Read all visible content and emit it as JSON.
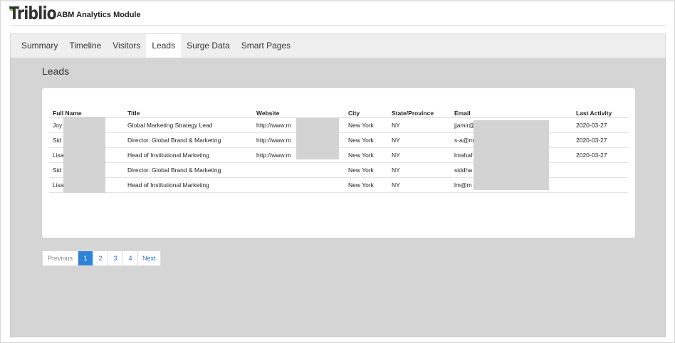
{
  "app": {
    "logo_text": "Triblio",
    "title": "ABM Analytics Module"
  },
  "tabs": [
    {
      "label": "Summary",
      "active": false
    },
    {
      "label": "Timeline",
      "active": false
    },
    {
      "label": "Visitors",
      "active": false
    },
    {
      "label": "Leads",
      "active": true
    },
    {
      "label": "Surge Data",
      "active": false
    },
    {
      "label": "Smart Pages",
      "active": false
    }
  ],
  "leads": {
    "heading": "Leads",
    "columns": [
      "Full Name",
      "Title",
      "Website",
      "City",
      "State/Province",
      "Email",
      "Last Activity"
    ],
    "rows": [
      [
        "Joy",
        "Global Marketing Strategy Lead",
        "http://www.m",
        "New York",
        "NY",
        "jjamir@",
        "2020-03-27"
      ],
      [
        "Sid",
        "Director. Global Brand & Marketing",
        "http://www.m",
        "New York",
        "NY",
        "s-a@m",
        "2020-03-27"
      ],
      [
        "Lisa",
        "Head of Institutional Marketing",
        "http://www.m",
        "New York",
        "NY",
        "lmahaf",
        "2020-03-27"
      ],
      [
        "Sid",
        "Director. Global Brand & Marketing",
        "",
        "New York",
        "NY",
        "siddha",
        ""
      ],
      [
        "Lisa",
        "Head of Institutional Marketing",
        "",
        "New York",
        "NY",
        "lm@m",
        ""
      ]
    ]
  },
  "pagination": {
    "previous": "Previous",
    "pages": [
      "1",
      "2",
      "3",
      "4"
    ],
    "current": "1",
    "next": "Next"
  },
  "colors": {
    "accent": "#2f83d6",
    "logo_green": "#6cc24a",
    "panel_bg": "#d5d5d5"
  }
}
